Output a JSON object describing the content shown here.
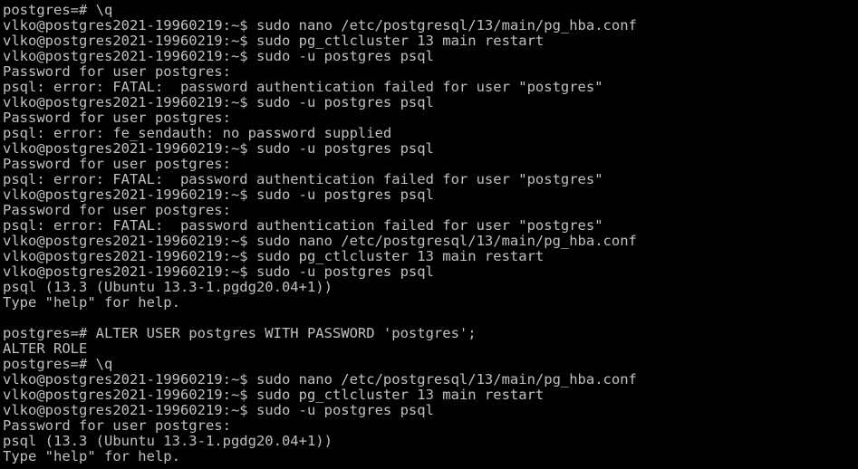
{
  "terminal": {
    "text_color": "#c0c0c0",
    "background_color": "#000000",
    "lines": [
      "postgres=# \\q",
      "vlko@postgres2021-19960219:~$ sudo nano /etc/postgresql/13/main/pg_hba.conf",
      "vlko@postgres2021-19960219:~$ sudo pg_ctlcluster 13 main restart",
      "vlko@postgres2021-19960219:~$ sudo -u postgres psql",
      "Password for user postgres:",
      "psql: error: FATAL:  password authentication failed for user \"postgres\"",
      "vlko@postgres2021-19960219:~$ sudo -u postgres psql",
      "Password for user postgres:",
      "psql: error: fe_sendauth: no password supplied",
      "vlko@postgres2021-19960219:~$ sudo -u postgres psql",
      "Password for user postgres:",
      "psql: error: FATAL:  password authentication failed for user \"postgres\"",
      "vlko@postgres2021-19960219:~$ sudo -u postgres psql",
      "Password for user postgres:",
      "psql: error: FATAL:  password authentication failed for user \"postgres\"",
      "vlko@postgres2021-19960219:~$ sudo nano /etc/postgresql/13/main/pg_hba.conf",
      "vlko@postgres2021-19960219:~$ sudo pg_ctlcluster 13 main restart",
      "vlko@postgres2021-19960219:~$ sudo -u postgres psql",
      "psql (13.3 (Ubuntu 13.3-1.pgdg20.04+1))",
      "Type \"help\" for help.",
      "",
      "postgres=# ALTER USER postgres WITH PASSWORD 'postgres';",
      "ALTER ROLE",
      "postgres=# \\q",
      "vlko@postgres2021-19960219:~$ sudo nano /etc/postgresql/13/main/pg_hba.conf",
      "vlko@postgres2021-19960219:~$ sudo pg_ctlcluster 13 main restart",
      "vlko@postgres2021-19960219:~$ sudo -u postgres psql",
      "Password for user postgres:",
      "psql (13.3 (Ubuntu 13.3-1.pgdg20.04+1))",
      "Type \"help\" for help."
    ]
  }
}
